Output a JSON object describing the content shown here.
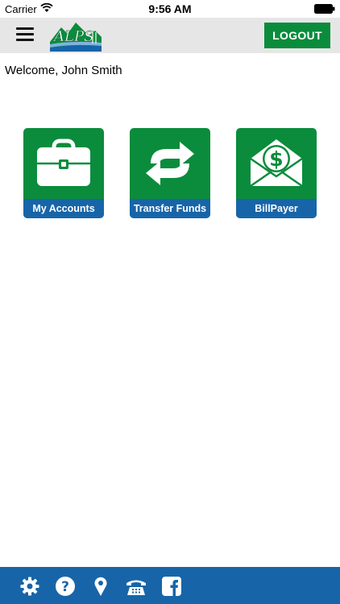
{
  "status_bar": {
    "carrier": "Carrier",
    "time": "9:56 AM"
  },
  "header": {
    "logout_label": "LOGOUT",
    "logo_text": "ALPS"
  },
  "welcome_text": "Welcome, John Smith",
  "tiles": [
    {
      "label": "My Accounts",
      "icon": "briefcase-icon"
    },
    {
      "label": "Transfer Funds",
      "icon": "transfer-arrows-icon"
    },
    {
      "label": "BillPayer",
      "icon": "bill-envelope-icon"
    }
  ],
  "bottom_bar": [
    "settings-icon",
    "help-icon",
    "location-icon",
    "phone-icon",
    "facebook-icon"
  ],
  "colors": {
    "brand_green": "#0a8c3c",
    "brand_blue": "#1765a8",
    "header_gray": "#e6e6e6"
  }
}
